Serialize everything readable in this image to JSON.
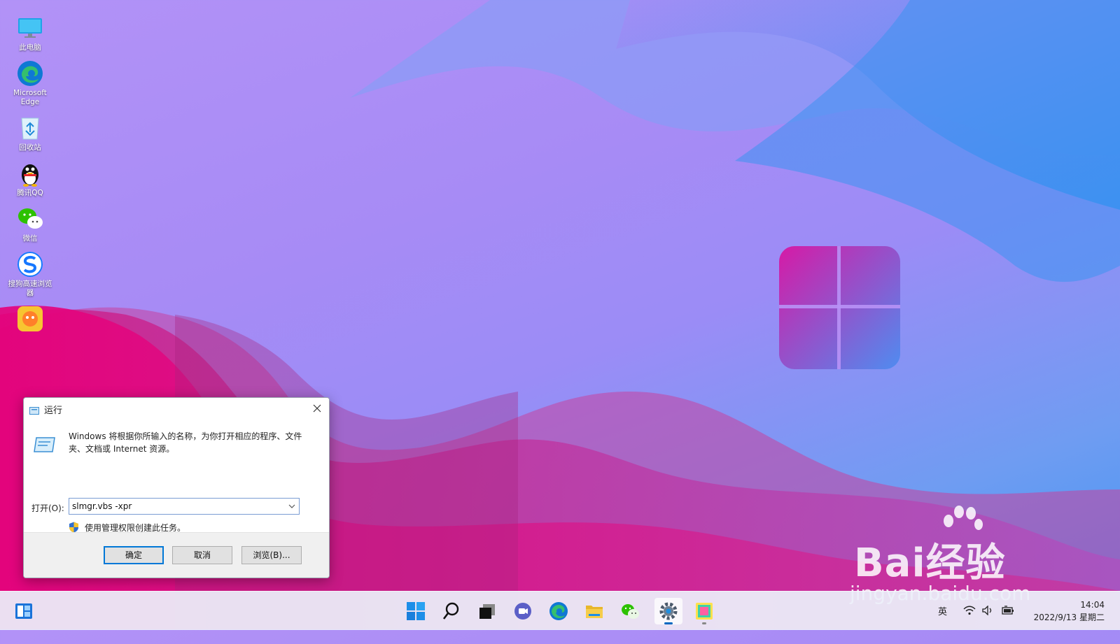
{
  "desktop": {
    "icons": [
      {
        "label": "此电脑"
      },
      {
        "label": "Microsoft Edge"
      },
      {
        "label": "回收站"
      },
      {
        "label": "腾讯QQ"
      },
      {
        "label": "微信"
      },
      {
        "label": "搜狗高速浏览器"
      }
    ]
  },
  "run_dialog": {
    "title": "运行",
    "description": "Windows 将根据你所输入的名称，为你打开相应的程序、文件夹、文档或 Internet 资源。",
    "open_label": "打开(O):",
    "command_value": "slmgr.vbs -xpr",
    "admin_note": "使用管理权限创建此任务。",
    "buttons": {
      "ok": "确定",
      "cancel": "取消",
      "browse": "浏览(B)..."
    }
  },
  "taskbar": {
    "ime": "英",
    "time": "14:04",
    "date": "2022/9/13 星期二"
  },
  "watermark": {
    "brand": "Bai经验",
    "url": "jingyan.baidu.com"
  },
  "colors": {
    "accent": "#0078d7",
    "taskbar_bg": "#ecf0fa"
  }
}
